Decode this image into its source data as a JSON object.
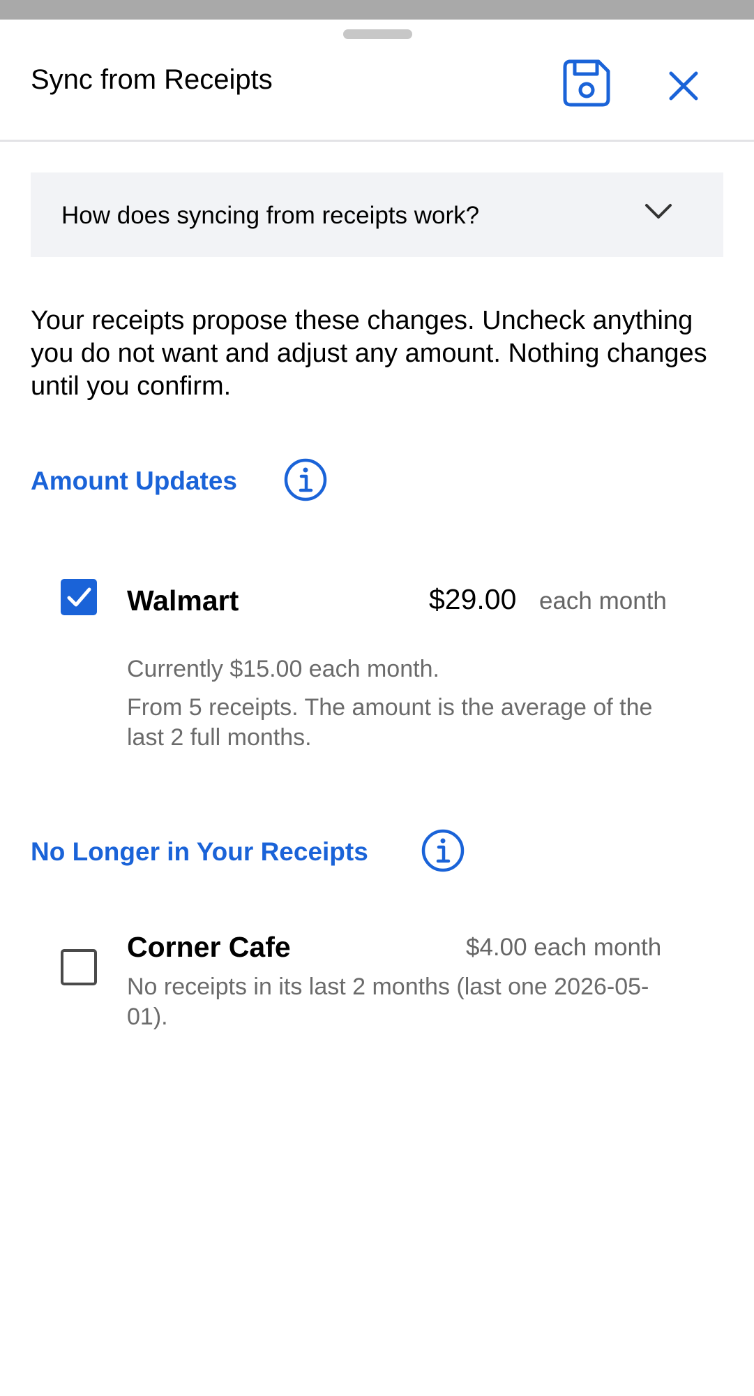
{
  "header": {
    "title": "Sync from Receipts",
    "save_icon": "floppy-disk-icon",
    "close_icon": "close-x-icon"
  },
  "faq": {
    "label": "How does syncing from receipts work?",
    "expanded": false
  },
  "intro_text": "Your receipts propose these changes. Uncheck anything you do not want and adjust any amount. Nothing changes until you confirm.",
  "sections": {
    "amount_updates": {
      "heading": "Amount Updates",
      "items": [
        {
          "name": "Walmart",
          "checked": true,
          "amount": "$29.00",
          "frequency": "each month",
          "current": "Currently $15.00 each month.",
          "detail": "From 5 receipts. The amount is the average of the last 2 full months."
        }
      ]
    },
    "no_longer": {
      "heading": "No Longer in Your Receipts",
      "items": [
        {
          "name": "Corner Cafe",
          "checked": false,
          "amount_text": "$4.00 each month",
          "detail": "No receipts in its last 2 months (last one 2026-05-01)."
        }
      ]
    }
  },
  "colors": {
    "accent": "#1a63d8",
    "top_bar": "#a9a9a9",
    "faq_bg": "#f2f3f6",
    "muted_text": "#6b6b6b"
  }
}
